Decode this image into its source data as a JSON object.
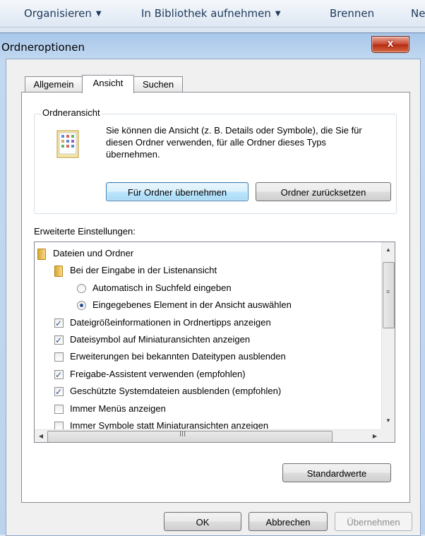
{
  "explorer": {
    "organize": "Organisieren",
    "library": "In Bibliothek aufnehmen",
    "burn": "Brennen",
    "new": "Ne"
  },
  "dialog": {
    "title": "Ordneroptionen",
    "close": "x"
  },
  "tabs": [
    "Allgemein",
    "Ansicht",
    "Suchen"
  ],
  "active_tab": "Ansicht",
  "folder_view": {
    "label": "Ordneransicht",
    "description": "Sie können die Ansicht (z. B. Details oder Symbole), die Sie für diesen Ordner verwenden, für alle Ordner dieses Typs übernehmen.",
    "apply_button": "Für Ordner übernehmen",
    "reset_button": "Ordner zurücksetzen"
  },
  "advanced": {
    "label": "Erweiterte Einstellungen:",
    "items": [
      {
        "type": "folder",
        "label": "Dateien und Ordner",
        "indent": 0
      },
      {
        "type": "folder",
        "label": "Bei der Eingabe in der Listenansicht",
        "indent": 1
      },
      {
        "type": "radio",
        "label": "Automatisch in Suchfeld eingeben",
        "checked": false,
        "indent": 2
      },
      {
        "type": "radio",
        "label": "Eingegebenes Element in der Ansicht auswählen",
        "checked": true,
        "indent": 2
      },
      {
        "type": "checkbox",
        "label": "Dateigrößeinformationen in Ordnertipps anzeigen",
        "checked": true,
        "indent": 1
      },
      {
        "type": "checkbox",
        "label": "Dateisymbol auf Miniaturansichten anzeigen",
        "checked": true,
        "indent": 1
      },
      {
        "type": "checkbox",
        "label": "Erweiterungen bei bekannten Dateitypen ausblenden",
        "checked": false,
        "indent": 1
      },
      {
        "type": "checkbox",
        "label": "Freigabe-Assistent verwenden (empfohlen)",
        "checked": true,
        "indent": 1
      },
      {
        "type": "checkbox",
        "label": "Geschützte Systemdateien ausblenden (empfohlen)",
        "checked": true,
        "indent": 1
      },
      {
        "type": "checkbox",
        "label": "Immer Menüs anzeigen",
        "checked": false,
        "indent": 1
      },
      {
        "type": "checkbox",
        "label": "Immer Symbole statt Miniaturansichten anzeigen",
        "checked": false,
        "indent": 1
      }
    ]
  },
  "defaults_button": "Standardwerte",
  "footer": {
    "ok": "OK",
    "cancel": "Abbrechen",
    "apply": "Übernehmen"
  }
}
